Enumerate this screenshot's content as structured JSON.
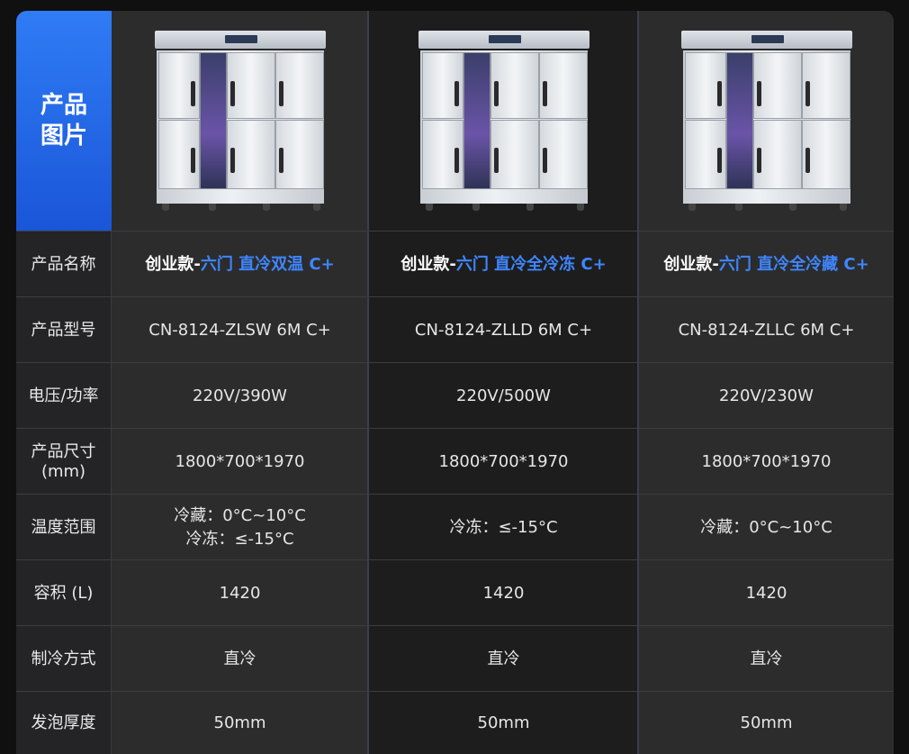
{
  "header": {
    "label": "产品\n图片"
  },
  "products": [
    {
      "name_prefix": "创业款-",
      "name_main": "六门 直冷双温 C+"
    },
    {
      "name_prefix": "创业款-",
      "name_main": "六门 直冷全冷冻 C+"
    },
    {
      "name_prefix": "创业款-",
      "name_main": "六门 直冷全冷藏 C+"
    }
  ],
  "rows": {
    "name": {
      "label": "产品名称"
    },
    "model": {
      "label": "产品型号",
      "values": [
        "CN-8124-ZLSW 6M C+",
        "CN-8124-ZLLD 6M C+",
        "CN-8124-ZLLC 6M C+"
      ]
    },
    "power": {
      "label": "电压/功率",
      "values": [
        "220V/390W",
        "220V/500W",
        "220V/230W"
      ]
    },
    "size": {
      "label_1": "产品尺寸",
      "label_2": "(mm)",
      "values": [
        "1800*700*1970",
        "1800*700*1970",
        "1800*700*1970"
      ]
    },
    "temp": {
      "label": "温度范围",
      "c1_line1": "冷藏：0°C~10°C",
      "c1_line2": "冷冻：≤-15°C",
      "c2": "冷冻：≤-15°C",
      "c3": "冷藏：0°C~10°C"
    },
    "volume": {
      "label": "容积 (L)",
      "values": [
        "1420",
        "1420",
        "1420"
      ]
    },
    "cooling": {
      "label": "制冷方式",
      "values": [
        "直冷",
        "直冷",
        "直冷"
      ]
    },
    "foam": {
      "label": "发泡厚度",
      "values": [
        "50mm",
        "50mm",
        "50mm"
      ]
    }
  },
  "colors": {
    "accent": "#3f86ff",
    "header_bg": "#1f63e6"
  }
}
